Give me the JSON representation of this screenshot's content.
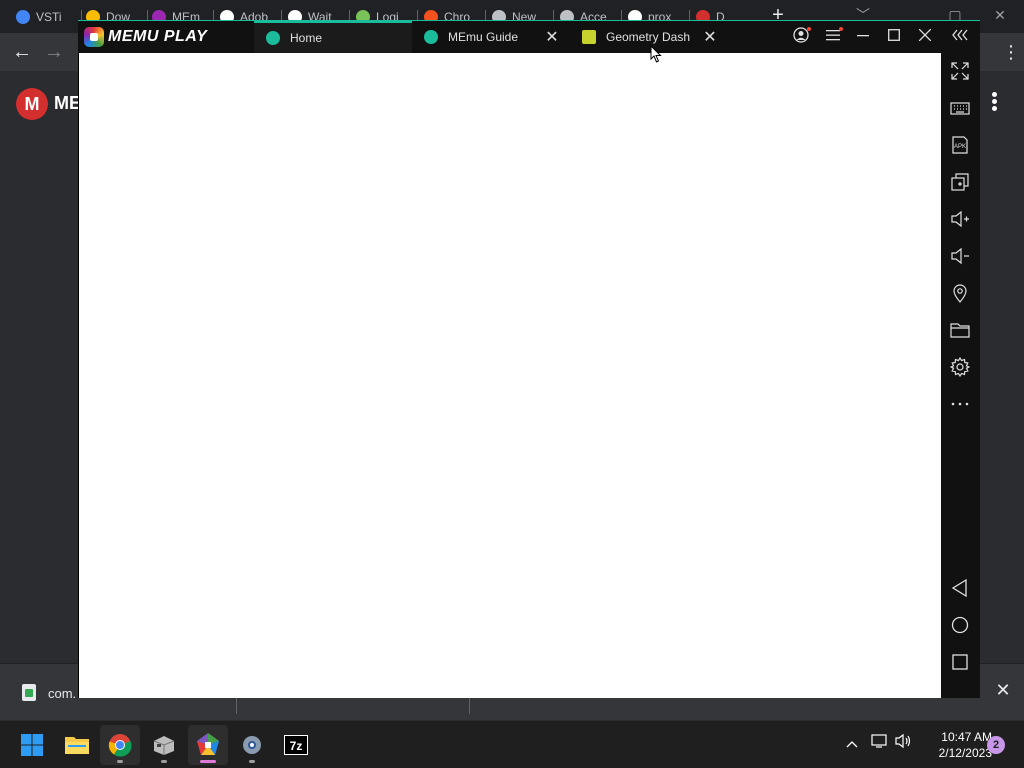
{
  "chrome": {
    "tabs": [
      {
        "label": "VSTi",
        "color": "#4285f4"
      },
      {
        "label": "Dow",
        "color": "#fbbc05"
      },
      {
        "label": "MEm",
        "color": "#9c27b0"
      },
      {
        "label": "Adob",
        "color": "#ffffff"
      },
      {
        "label": "Wait",
        "color": "#ffffff"
      },
      {
        "label": "Logi",
        "color": "#78c257"
      },
      {
        "label": "Chro",
        "color": "#f4511e"
      },
      {
        "label": "New",
        "color": "#bdc1c6"
      },
      {
        "label": "Acce",
        "color": "#bdc1c6"
      },
      {
        "label": "prox",
        "color": "#ffffff"
      },
      {
        "label": "D",
        "color": "#d32f2f"
      }
    ],
    "new_tab": "+",
    "min": "﹀",
    "restore": "▢",
    "close": "✕",
    "back": "←",
    "forward": "→",
    "menu": "⋮"
  },
  "web": {
    "logo_letter": "M",
    "logo_text": "ME"
  },
  "download_bar": {
    "file_name": "com.",
    "close": "✕"
  },
  "memu": {
    "logo_text": "MEMU PLAY",
    "tabs": [
      {
        "label": "Home",
        "icon_color": "#1abc9c",
        "active": true
      },
      {
        "label": "MEmu Guide",
        "icon_color": "#1abc9c",
        "close": "✕"
      },
      {
        "label": "Geometry Dash",
        "icon_color": "#c6d22e",
        "close": "✕"
      }
    ],
    "controls": {
      "account": "◯",
      "menu": "≡",
      "minimize": "—",
      "maximize": "☐",
      "close": "✕",
      "collapse": "«"
    },
    "sidebar": [
      "fullscreen-icon",
      "keyboard-icon",
      "apk-icon",
      "multi-window-icon",
      "volume-up-icon",
      "volume-down-icon",
      "location-icon",
      "folder-icon",
      "settings-icon",
      "more-icon",
      "back-icon",
      "home-icon",
      "recents-icon"
    ],
    "apk_label": "APK"
  },
  "taskbar": {
    "apps": [
      "start",
      "file-explorer",
      "chrome",
      "package-tool",
      "memu",
      "settings",
      "7zip"
    ],
    "sevenzip_label": "7z",
    "tray_chevron": "^",
    "time": "10:47 AM",
    "date": "2/12/2023",
    "notifications": "2"
  }
}
